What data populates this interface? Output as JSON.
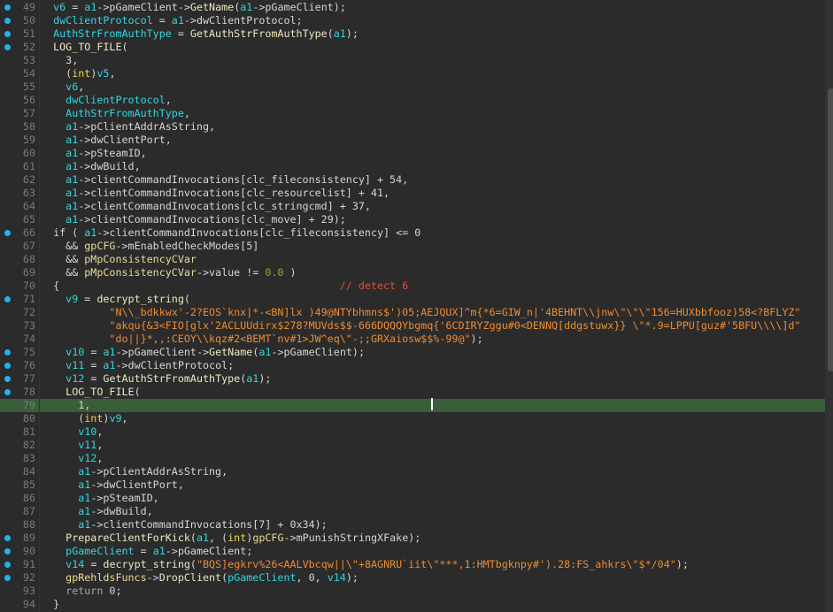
{
  "colors": {
    "background": "#2b2b2b",
    "highlight": "#3a5e3a",
    "breakpoint_dot": "#1fb3f0",
    "variable": "#33d6e0",
    "global": "#eadb9a",
    "string": "#ec8c34",
    "comment": "#d75535"
  },
  "cursor_line": 79,
  "lines": [
    {
      "n": "49",
      "dot": true,
      "tokens": [
        [
          "t",
          "  "
        ],
        [
          "v",
          "v6"
        ],
        [
          "t",
          " = "
        ],
        [
          "v",
          "a1"
        ],
        [
          "t",
          "->pGameClient->"
        ],
        [
          "f",
          "GetName"
        ],
        [
          "t",
          "("
        ],
        [
          "v",
          "a1"
        ],
        [
          "t",
          "->pGameClient);"
        ]
      ]
    },
    {
      "n": "50",
      "dot": true,
      "tokens": [
        [
          "t",
          "  "
        ],
        [
          "v",
          "dwClientProtocol"
        ],
        [
          "t",
          " = "
        ],
        [
          "v",
          "a1"
        ],
        [
          "t",
          "->dwClientProtocol;"
        ]
      ]
    },
    {
      "n": "51",
      "dot": true,
      "tokens": [
        [
          "t",
          "  "
        ],
        [
          "v",
          "AuthStrFromAuthType"
        ],
        [
          "t",
          " = "
        ],
        [
          "f",
          "GetAuthStrFromAuthType"
        ],
        [
          "t",
          "("
        ],
        [
          "v",
          "a1"
        ],
        [
          "t",
          ");"
        ]
      ]
    },
    {
      "n": "52",
      "dot": true,
      "tokens": [
        [
          "t",
          "  "
        ],
        [
          "f",
          "LOG_TO_FILE"
        ],
        [
          "t",
          "("
        ]
      ]
    },
    {
      "n": "53",
      "dot": false,
      "tokens": [
        [
          "t",
          "    "
        ],
        [
          "n",
          "3"
        ],
        [
          "t",
          ","
        ]
      ]
    },
    {
      "n": "54",
      "dot": false,
      "tokens": [
        [
          "t",
          "    ("
        ],
        [
          "k",
          "int"
        ],
        [
          "t",
          ")"
        ],
        [
          "v",
          "v5"
        ],
        [
          "t",
          ","
        ]
      ]
    },
    {
      "n": "55",
      "dot": false,
      "tokens": [
        [
          "t",
          "    "
        ],
        [
          "v",
          "v6"
        ],
        [
          "t",
          ","
        ]
      ]
    },
    {
      "n": "56",
      "dot": false,
      "tokens": [
        [
          "t",
          "    "
        ],
        [
          "v",
          "dwClientProtocol"
        ],
        [
          "t",
          ","
        ]
      ]
    },
    {
      "n": "57",
      "dot": false,
      "tokens": [
        [
          "t",
          "    "
        ],
        [
          "v",
          "AuthStrFromAuthType"
        ],
        [
          "t",
          ","
        ]
      ]
    },
    {
      "n": "58",
      "dot": false,
      "tokens": [
        [
          "t",
          "    "
        ],
        [
          "v",
          "a1"
        ],
        [
          "t",
          "->pClientAddrAsString,"
        ]
      ]
    },
    {
      "n": "59",
      "dot": false,
      "tokens": [
        [
          "t",
          "    "
        ],
        [
          "v",
          "a1"
        ],
        [
          "t",
          "->dwClientPort,"
        ]
      ]
    },
    {
      "n": "60",
      "dot": false,
      "tokens": [
        [
          "t",
          "    "
        ],
        [
          "v",
          "a1"
        ],
        [
          "t",
          "->pSteamID,"
        ]
      ]
    },
    {
      "n": "61",
      "dot": false,
      "tokens": [
        [
          "t",
          "    "
        ],
        [
          "v",
          "a1"
        ],
        [
          "t",
          "->dwBuild,"
        ]
      ]
    },
    {
      "n": "62",
      "dot": false,
      "tokens": [
        [
          "t",
          "    "
        ],
        [
          "v",
          "a1"
        ],
        [
          "t",
          "->clientCommandInvocations[clc_fileconsistency] + 54,"
        ]
      ]
    },
    {
      "n": "63",
      "dot": false,
      "tokens": [
        [
          "t",
          "    "
        ],
        [
          "v",
          "a1"
        ],
        [
          "t",
          "->clientCommandInvocations[clc_resourcelist] + 41,"
        ]
      ]
    },
    {
      "n": "64",
      "dot": false,
      "tokens": [
        [
          "t",
          "    "
        ],
        [
          "v",
          "a1"
        ],
        [
          "t",
          "->clientCommandInvocations[clc_stringcmd] + 37,"
        ]
      ]
    },
    {
      "n": "65",
      "dot": false,
      "tokens": [
        [
          "t",
          "    "
        ],
        [
          "v",
          "a1"
        ],
        [
          "t",
          "->clientCommandInvocations[clc_move] + 29);"
        ]
      ]
    },
    {
      "n": "66",
      "dot": true,
      "tokens": [
        [
          "t",
          "  if ( "
        ],
        [
          "v",
          "a1"
        ],
        [
          "t",
          "->clientCommandInvocations[clc_fileconsistency] <= 0"
        ]
      ]
    },
    {
      "n": "67",
      "dot": false,
      "tokens": [
        [
          "t",
          "    && "
        ],
        [
          "g",
          "gpCFG"
        ],
        [
          "t",
          "->mEnabledCheckModes[5]"
        ]
      ]
    },
    {
      "n": "68",
      "dot": false,
      "tokens": [
        [
          "t",
          "    && "
        ],
        [
          "g",
          "pMpConsistencyCVar"
        ]
      ]
    },
    {
      "n": "69",
      "dot": false,
      "tokens": [
        [
          "t",
          "    && "
        ],
        [
          "g",
          "pMpConsistencyCVar"
        ],
        [
          "t",
          "->value != "
        ],
        [
          "fl",
          "0.0"
        ],
        [
          "t",
          " )"
        ]
      ]
    },
    {
      "n": "70",
      "dot": false,
      "tokens": [
        [
          "t",
          "  {                                             "
        ],
        [
          "c",
          "// detect 6"
        ]
      ]
    },
    {
      "n": "71",
      "dot": true,
      "tokens": [
        [
          "t",
          "    "
        ],
        [
          "v",
          "v9"
        ],
        [
          "t",
          " = "
        ],
        [
          "f",
          "decrypt_string"
        ],
        [
          "t",
          "("
        ]
      ]
    },
    {
      "n": "72",
      "dot": false,
      "tokens": [
        [
          "t",
          "           "
        ],
        [
          "s",
          "\"N\\\\_bdkkwx'-2?EOS`knx|*-<BN]lx )49@NTYbhmns$')05;AEJQUX]^m{*6=GIW_n|'4BEHNT\\\\jnw\\\"\\\"\\\"156=HUXbbfooz)58<?BFLYZ\""
        ]
      ]
    },
    {
      "n": "73",
      "dot": false,
      "tokens": [
        [
          "t",
          "           "
        ],
        [
          "s",
          "\"akqu{&3<FIO[glx'2ACLUUdirx$278?MUVds$$-666DQQQYbgmq{'6CDIRYZggu#0<DENNQ[ddgstuwx}} \\\"*.9=LPPU[guz#'5BFU\\\\\\\\]d\""
        ]
      ]
    },
    {
      "n": "74",
      "dot": false,
      "tokens": [
        [
          "t",
          "           "
        ],
        [
          "s",
          "\"do||}*,,:CEOY\\\\kqz#2<BEMT`nv#1>JW^eq\\\"-;;GRXaiosw$$%-99@\""
        ],
        [
          "t",
          ");"
        ]
      ]
    },
    {
      "n": "75",
      "dot": true,
      "tokens": [
        [
          "t",
          "    "
        ],
        [
          "v",
          "v10"
        ],
        [
          "t",
          " = "
        ],
        [
          "v",
          "a1"
        ],
        [
          "t",
          "->pGameClient->"
        ],
        [
          "f",
          "GetName"
        ],
        [
          "t",
          "("
        ],
        [
          "v",
          "a1"
        ],
        [
          "t",
          "->pGameClient);"
        ]
      ]
    },
    {
      "n": "76",
      "dot": true,
      "tokens": [
        [
          "t",
          "    "
        ],
        [
          "v",
          "v11"
        ],
        [
          "t",
          " = "
        ],
        [
          "v",
          "a1"
        ],
        [
          "t",
          "->dwClientProtocol;"
        ]
      ]
    },
    {
      "n": "77",
      "dot": true,
      "tokens": [
        [
          "t",
          "    "
        ],
        [
          "v",
          "v12"
        ],
        [
          "t",
          " = "
        ],
        [
          "f",
          "GetAuthStrFromAuthType"
        ],
        [
          "t",
          "("
        ],
        [
          "v",
          "a1"
        ],
        [
          "t",
          ");"
        ]
      ]
    },
    {
      "n": "78",
      "dot": true,
      "tokens": [
        [
          "t",
          "    "
        ],
        [
          "f",
          "LOG_TO_FILE"
        ],
        [
          "t",
          "("
        ]
      ]
    },
    {
      "n": "79",
      "dot": false,
      "tokens": [
        [
          "t",
          "      "
        ],
        [
          "n",
          "1"
        ],
        [
          "t",
          ","
        ]
      ]
    },
    {
      "n": "80",
      "dot": false,
      "tokens": [
        [
          "t",
          "      ("
        ],
        [
          "k",
          "int"
        ],
        [
          "t",
          ")"
        ],
        [
          "v",
          "v9"
        ],
        [
          "t",
          ","
        ]
      ]
    },
    {
      "n": "81",
      "dot": false,
      "tokens": [
        [
          "t",
          "      "
        ],
        [
          "v",
          "v10"
        ],
        [
          "t",
          ","
        ]
      ]
    },
    {
      "n": "82",
      "dot": false,
      "tokens": [
        [
          "t",
          "      "
        ],
        [
          "v",
          "v11"
        ],
        [
          "t",
          ","
        ]
      ]
    },
    {
      "n": "83",
      "dot": false,
      "tokens": [
        [
          "t",
          "      "
        ],
        [
          "v",
          "v12"
        ],
        [
          "t",
          ","
        ]
      ]
    },
    {
      "n": "84",
      "dot": false,
      "tokens": [
        [
          "t",
          "      "
        ],
        [
          "v",
          "a1"
        ],
        [
          "t",
          "->pClientAddrAsString,"
        ]
      ]
    },
    {
      "n": "85",
      "dot": false,
      "tokens": [
        [
          "t",
          "      "
        ],
        [
          "v",
          "a1"
        ],
        [
          "t",
          "->dwClientPort,"
        ]
      ]
    },
    {
      "n": "86",
      "dot": false,
      "tokens": [
        [
          "t",
          "      "
        ],
        [
          "v",
          "a1"
        ],
        [
          "t",
          "->pSteamID,"
        ]
      ]
    },
    {
      "n": "87",
      "dot": false,
      "tokens": [
        [
          "t",
          "      "
        ],
        [
          "v",
          "a1"
        ],
        [
          "t",
          "->dwBuild,"
        ]
      ]
    },
    {
      "n": "88",
      "dot": false,
      "tokens": [
        [
          "t",
          "      "
        ],
        [
          "v",
          "a1"
        ],
        [
          "t",
          "->clientCommandInvocations[7] + 0x34);"
        ]
      ]
    },
    {
      "n": "89",
      "dot": true,
      "tokens": [
        [
          "t",
          "    "
        ],
        [
          "f",
          "PrepareClientForKick"
        ],
        [
          "t",
          "("
        ],
        [
          "v",
          "a1"
        ],
        [
          "t",
          ", ("
        ],
        [
          "k",
          "int"
        ],
        [
          "t",
          ")"
        ],
        [
          "g",
          "gpCFG"
        ],
        [
          "t",
          "->mPunishStringXFake);"
        ]
      ]
    },
    {
      "n": "90",
      "dot": true,
      "tokens": [
        [
          "t",
          "    "
        ],
        [
          "v",
          "pGameClient"
        ],
        [
          "t",
          " = "
        ],
        [
          "v",
          "a1"
        ],
        [
          "t",
          "->pGameClient;"
        ]
      ]
    },
    {
      "n": "91",
      "dot": true,
      "tokens": [
        [
          "t",
          "    "
        ],
        [
          "v",
          "v14"
        ],
        [
          "t",
          " = "
        ],
        [
          "f",
          "decrypt_string"
        ],
        [
          "t",
          "("
        ],
        [
          "s",
          "\"BQS]egkrv%26<AALVbcqw||\\\"+8AGNRU`iit\\\"***,1:HMTbgknpy#').28:FS_ahkrs\\\"$*/04\""
        ],
        [
          "t",
          ");"
        ]
      ]
    },
    {
      "n": "92",
      "dot": true,
      "tokens": [
        [
          "t",
          "    "
        ],
        [
          "g",
          "gpRehldsFuncs"
        ],
        [
          "t",
          "->"
        ],
        [
          "f",
          "DropClient"
        ],
        [
          "t",
          "("
        ],
        [
          "v",
          "pGameClient"
        ],
        [
          "t",
          ", 0, "
        ],
        [
          "v",
          "v14"
        ],
        [
          "t",
          ");"
        ]
      ]
    },
    {
      "n": "93",
      "dot": false,
      "tokens": [
        [
          "t",
          "    "
        ],
        [
          "r",
          "return"
        ],
        [
          "t",
          " 0;"
        ]
      ]
    },
    {
      "n": "94",
      "dot": false,
      "tokens": [
        [
          "t",
          "  }"
        ]
      ]
    }
  ]
}
